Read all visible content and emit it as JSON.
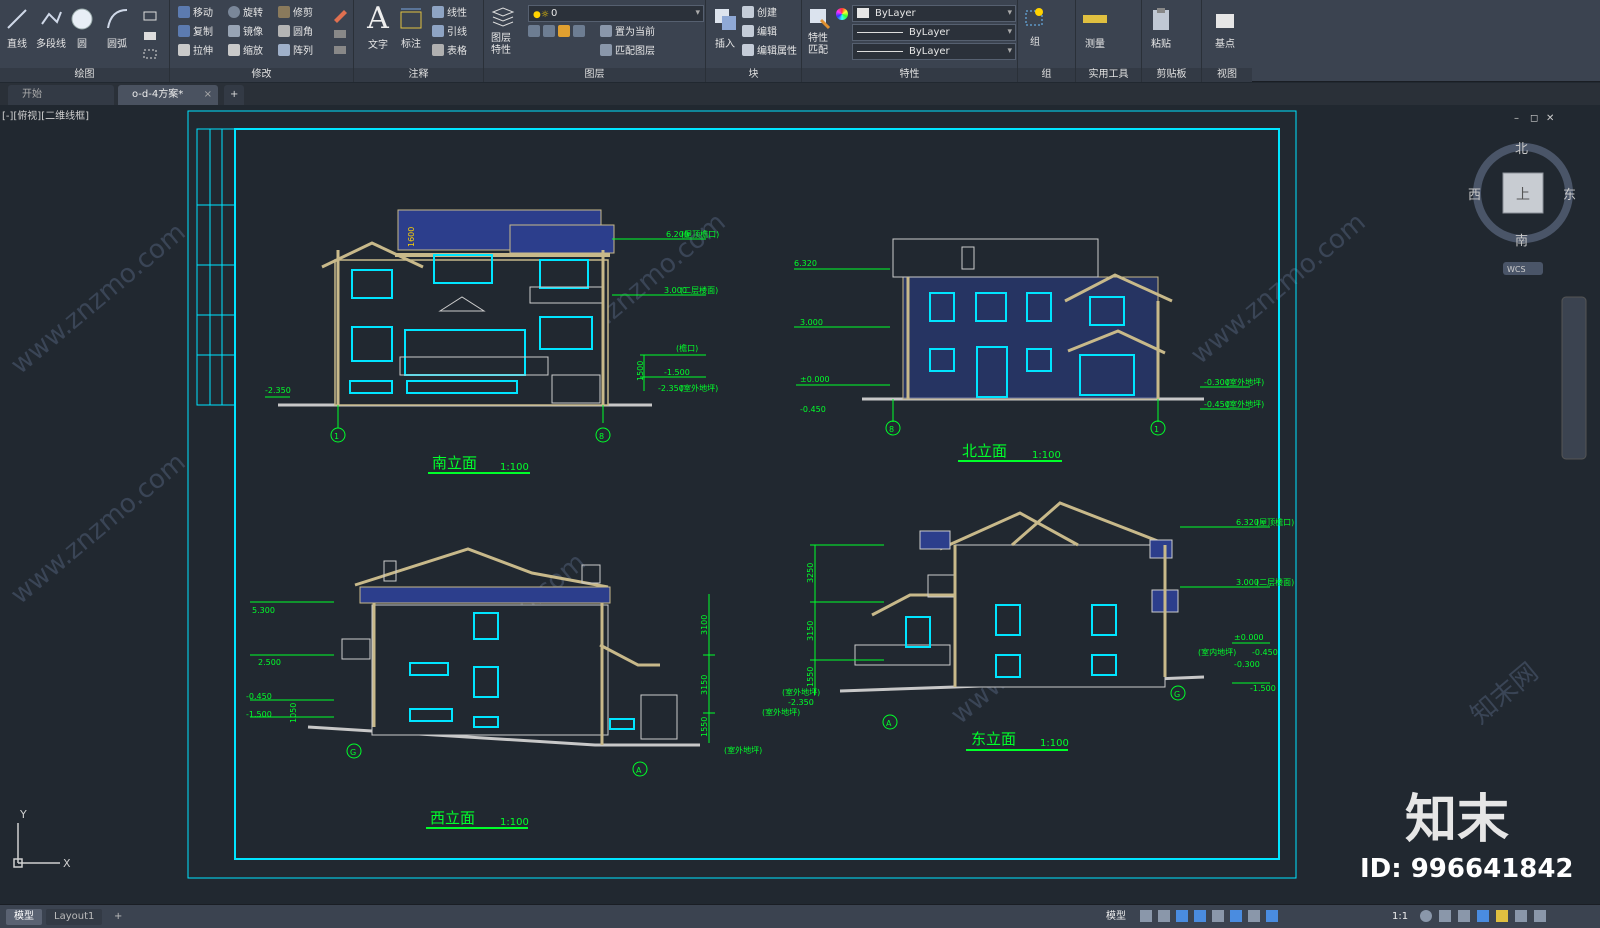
{
  "ribbon": {
    "draw": {
      "title": "绘图",
      "line": "直线",
      "polyline": "多段线",
      "circle": "圆",
      "arc": "圆弧"
    },
    "modify": {
      "title": "修改",
      "items": [
        "移动",
        "旋转",
        "修剪",
        "复制",
        "镜像",
        "圆角",
        "拉伸",
        "缩放",
        "阵列"
      ]
    },
    "annotation": {
      "title": "注释",
      "text": "文字",
      "dim": "标注",
      "items": [
        "线性",
        "引线",
        "表格"
      ]
    },
    "layers": {
      "title": "图层",
      "props": "图层特性",
      "current": "0",
      "items": [
        "置为当前",
        "匹配图层"
      ]
    },
    "block": {
      "title": "块",
      "insert": "插入",
      "items": [
        "创建",
        "编辑",
        "编辑属性"
      ]
    },
    "properties": {
      "title": "特性",
      "match": "特性匹配",
      "color": "ByLayer",
      "linetype": "ByLayer",
      "lineweight": "ByLayer"
    },
    "groups": {
      "title": "组",
      "group": "组"
    },
    "utilities": {
      "title": "实用工具",
      "measure": "测量"
    },
    "clipboard": {
      "title": "剪贴板",
      "paste": "粘贴"
    },
    "view": {
      "title": "视图",
      "base": "基点"
    }
  },
  "tabs": {
    "start": "开始",
    "doc": "o-d-4方案*",
    "add": "+"
  },
  "viewport": {
    "label": "[-][俯视][二维线框]",
    "ctrl": [
      "–",
      "◻",
      "✕"
    ]
  },
  "viewcube": {
    "n": "北",
    "s": "南",
    "e": "东",
    "w": "西",
    "top": "上",
    "wcs": "WCS"
  },
  "drawings": {
    "south": {
      "title": "南立面",
      "scale": "1:100",
      "axes": [
        "1",
        "8"
      ],
      "levels": [
        "6.200",
        "3.000",
        "-1.500",
        "-2.350",
        "-2.350"
      ],
      "notes": [
        "(屋顶檐口)",
        "(二层楼面)",
        "(檐口)",
        "(室外地坪)"
      ],
      "dim": "1500",
      "dim2": "1600"
    },
    "north": {
      "title": "北立面",
      "scale": "1:100",
      "axes": [
        "8",
        "1"
      ],
      "levels": [
        "6.320",
        "3.000",
        "±0.000",
        "-0.450",
        "-0.300",
        "-0.450"
      ],
      "notes": [
        "(室外地坪)",
        "(室外地坪)"
      ]
    },
    "west": {
      "title": "西立面",
      "scale": "1:100",
      "axes": [
        "G",
        "A"
      ],
      "levels": [
        "5.300",
        "2.500",
        "-0.450",
        "-1.500"
      ],
      "dims": [
        "3100",
        "3150",
        "1550",
        "1050"
      ],
      "notes": [
        "(室外地坪)"
      ]
    },
    "east": {
      "title": "东立面",
      "scale": "1:100",
      "axes": [
        "A",
        "G"
      ],
      "levels": [
        "6.320",
        "3.000",
        "±0.000",
        "-0.450",
        "-0.300",
        "-1.500",
        "-2.350"
      ],
      "dims": [
        "3250",
        "3150",
        "1550"
      ],
      "notes": [
        "(屋顶檐口)",
        "(二层楼面)",
        "(室内地坪)",
        "(室外地坪)",
        "(室外地坪)"
      ]
    }
  },
  "ucs": {
    "x": "X",
    "y": "Y"
  },
  "watermark": {
    "brand": "知末",
    "id": "ID: 996641842",
    "site": "www.znzmo.com",
    "cn": "知末网"
  },
  "status": {
    "model": "模型",
    "layout": "Layout1",
    "add": "+",
    "right": "模型",
    "scale": "1:1"
  },
  "colors": {
    "cyan": "#00e5ff",
    "green": "#00ff2a",
    "tan": "#c8b98a",
    "yellow": "#ffd200",
    "blue": "#2c3e8c"
  }
}
